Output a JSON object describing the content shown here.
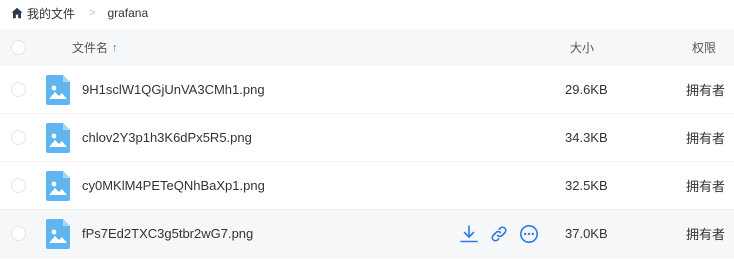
{
  "breadcrumb": {
    "root": "我的文件",
    "separator": ">",
    "current": "grafana"
  },
  "header": {
    "name": "文件名",
    "sort_arrow": "↑",
    "size": "大小",
    "permission": "权限"
  },
  "files": [
    {
      "name": "9H1sclW1QGjUnVA3CMh1.png",
      "size": "29.6KB",
      "permission": "拥有者"
    },
    {
      "name": "chlov2Y3p1h3K6dPx5R5.png",
      "size": "34.3KB",
      "permission": "拥有者"
    },
    {
      "name": "cy0MKlM4PETeQNhBaXp1.png",
      "size": "32.5KB",
      "permission": "拥有者"
    },
    {
      "name": "fPs7Ed2TXC3g5tbr2wG7.png",
      "size": "37.0KB",
      "permission": "拥有者"
    }
  ],
  "icons": {
    "home": "home-icon",
    "file": "image-file-icon",
    "download": "download-icon",
    "link": "link-icon",
    "more": "more-icon"
  },
  "colors": {
    "accent": "#2d7be5",
    "file_icon": "#5fb5f0",
    "header_bg": "#f6f7f9"
  }
}
